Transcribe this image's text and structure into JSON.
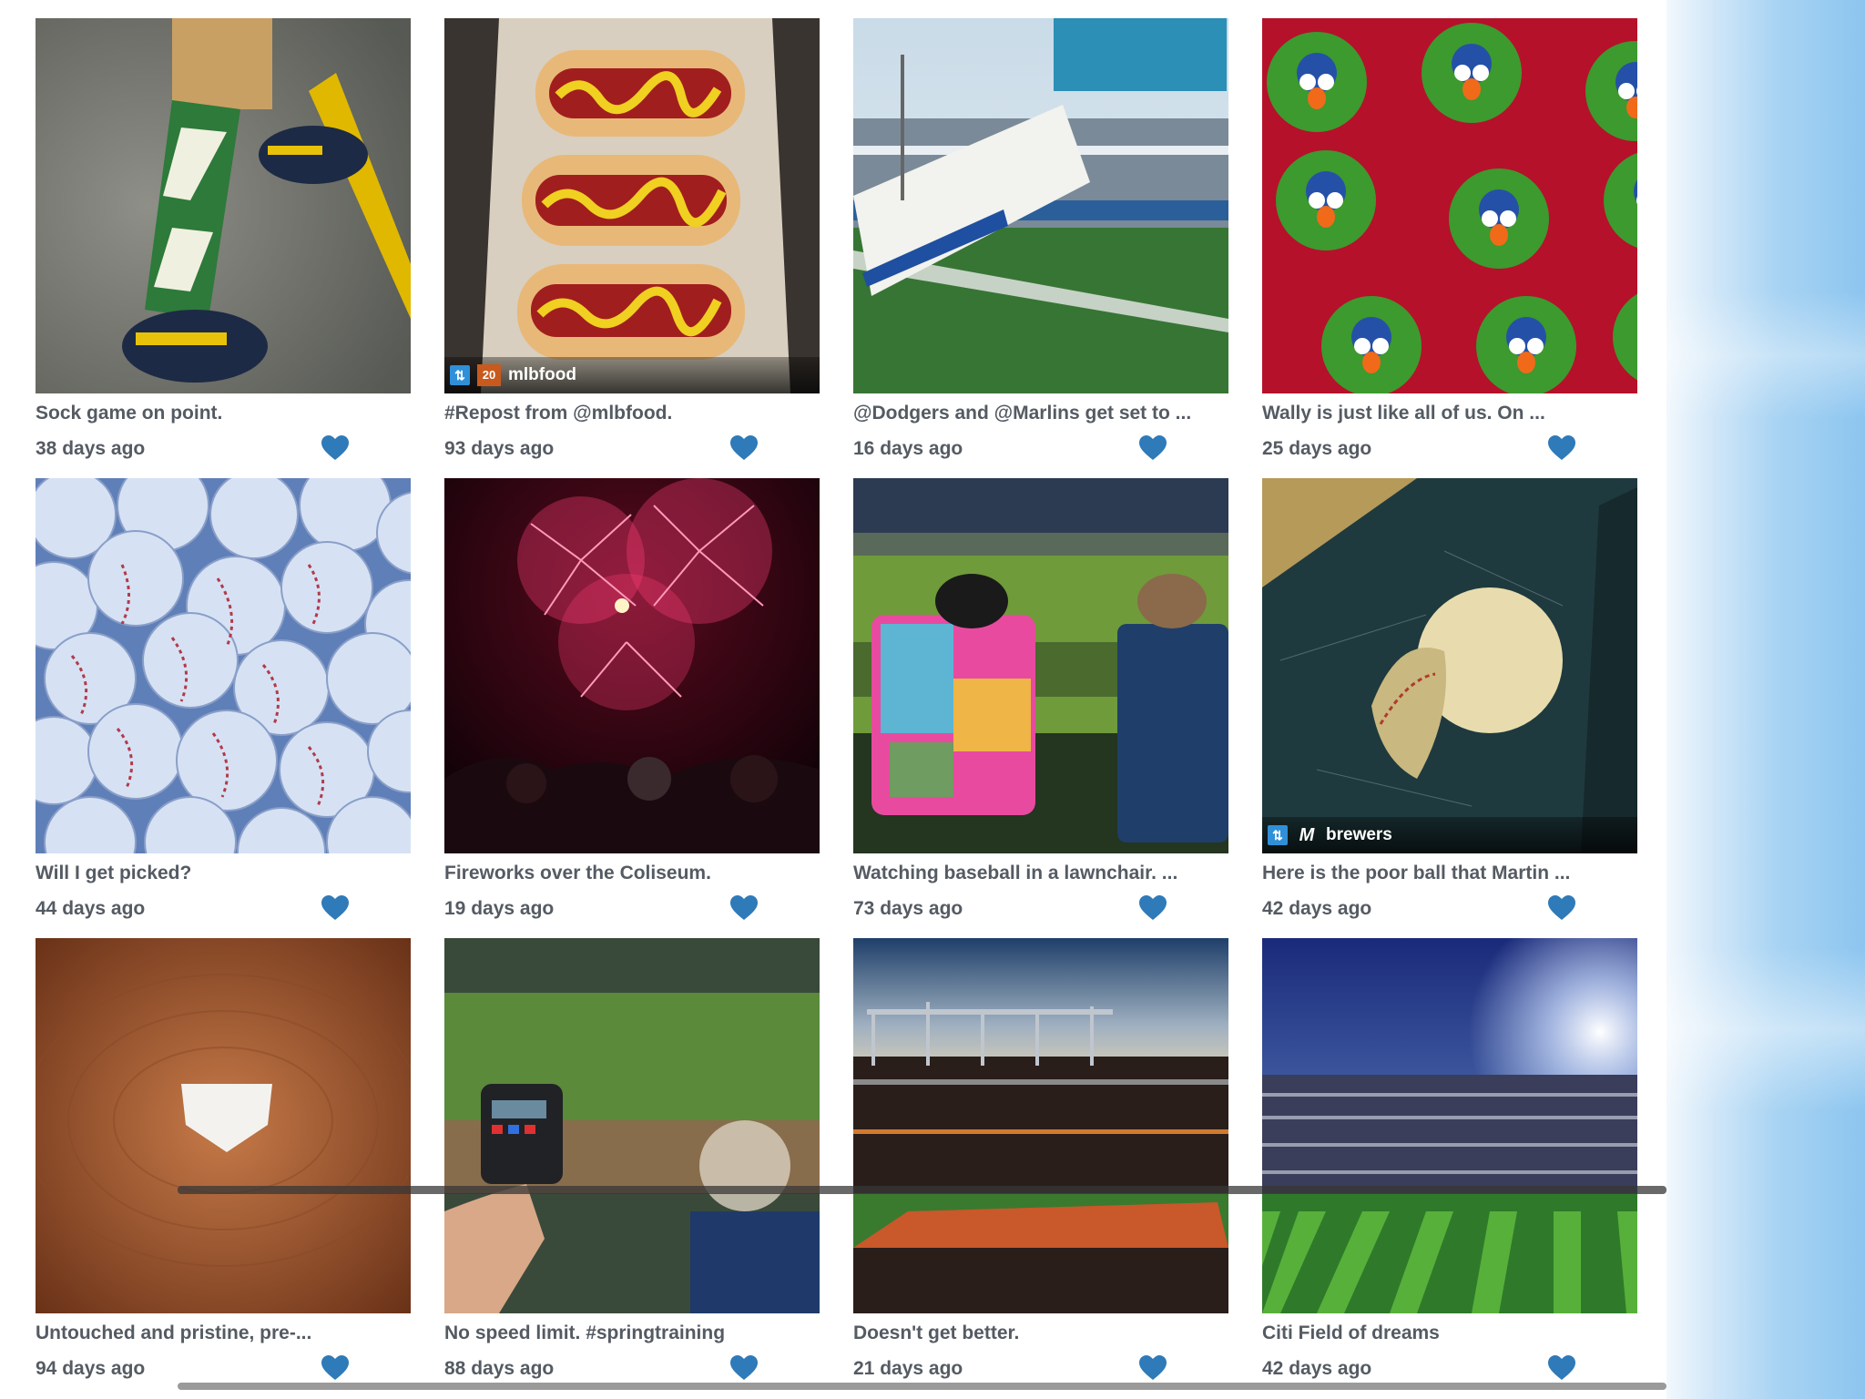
{
  "colors": {
    "caption_text": "#555b63",
    "heart": "#2f7ab8",
    "side_panel": "#a9d4f3"
  },
  "posts": [
    {
      "caption": "Sock game on point.",
      "age": "38 days ago",
      "icon": "heart-icon"
    },
    {
      "caption": "#Repost from @mlbfood.",
      "age": "93 days ago",
      "icon": "heart-icon",
      "repost_user": "mlbfood"
    },
    {
      "caption": "@Dodgers and @Marlins get set to ...",
      "age": "16 days ago",
      "icon": "heart-icon"
    },
    {
      "caption": "Wally is just like all of us. On ...",
      "age": "25 days ago",
      "icon": "heart-icon"
    },
    {
      "caption": "Will I get picked?",
      "age": "44 days ago",
      "icon": "heart-icon"
    },
    {
      "caption": "Fireworks over the Coliseum.",
      "age": "19 days ago",
      "icon": "heart-icon"
    },
    {
      "caption": "Watching baseball in a lawnchair. ...",
      "age": "73 days ago",
      "icon": "heart-icon"
    },
    {
      "caption": "Here is the poor ball that Martin ...",
      "age": "42 days ago",
      "icon": "heart-icon",
      "repost_user": "brewers"
    },
    {
      "caption": "Untouched and pristine, pre-...",
      "age": "94 days ago",
      "icon": "heart-icon"
    },
    {
      "caption": "No speed limit. #springtraining",
      "age": "88 days ago",
      "icon": "heart-icon"
    },
    {
      "caption": "Doesn't get better.",
      "age": "21 days ago",
      "icon": "heart-icon"
    },
    {
      "caption": "Citi Field of dreams",
      "age": "42 days ago",
      "icon": "heart-icon"
    }
  ]
}
